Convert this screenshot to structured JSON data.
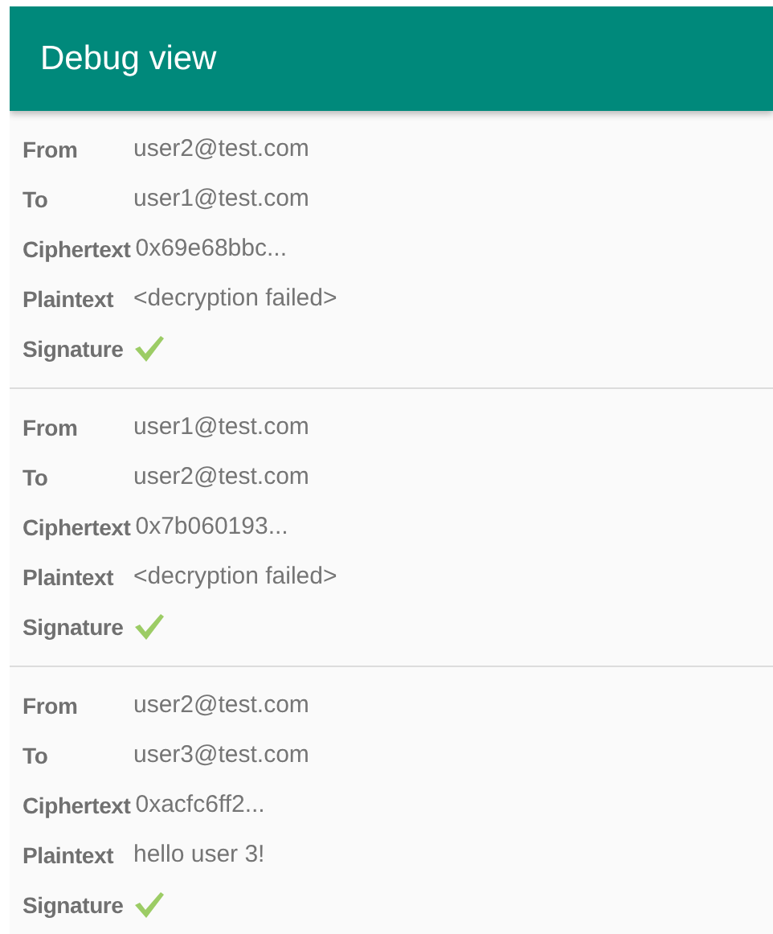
{
  "app_bar": {
    "title": "Debug view"
  },
  "messages": [
    {
      "from_label": "From",
      "from": "user2@test.com",
      "to_label": "To",
      "to": "user1@test.com",
      "ciphertext_label": "Ciphertext",
      "ciphertext": "0x69e68bbc...",
      "plaintext_label": "Plaintext",
      "plaintext": "<decryption failed>",
      "signature_label": "Signature",
      "signature_valid": true
    },
    {
      "from_label": "From",
      "from": "user1@test.com",
      "to_label": "To",
      "to": "user2@test.com",
      "ciphertext_label": "Ciphertext",
      "ciphertext": "0x7b060193...",
      "plaintext_label": "Plaintext",
      "plaintext": "<decryption failed>",
      "signature_label": "Signature",
      "signature_valid": true
    },
    {
      "from_label": "From",
      "from": "user2@test.com",
      "to_label": "To",
      "to": "user3@test.com",
      "ciphertext_label": "Ciphertext",
      "ciphertext": "0xacfc6ff2...",
      "plaintext_label": "Plaintext",
      "plaintext": "hello user 3!",
      "signature_label": "Signature",
      "signature_valid": true
    }
  ]
}
